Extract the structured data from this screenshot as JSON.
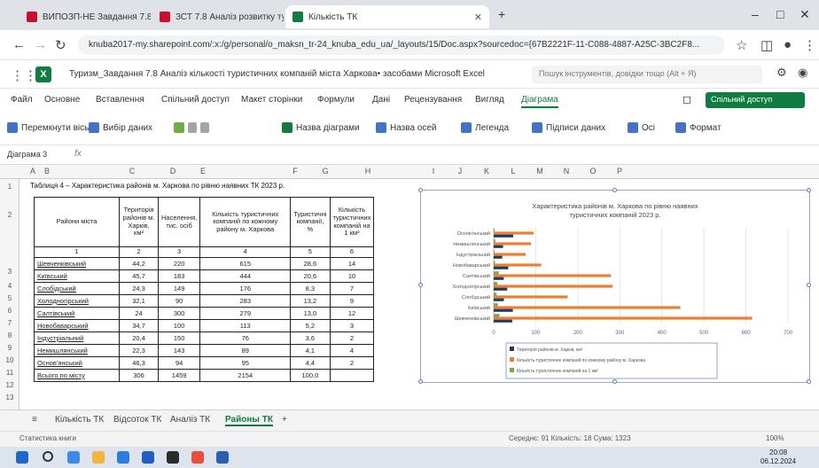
{
  "browser": {
    "tabs": [
      {
        "label": "ВИПОЗП-НЕ Завдання 7.8 Прог",
        "active": false
      },
      {
        "label": "ЗСТ 7.8 Аналіз розвитку турис",
        "active": false
      },
      {
        "label": "Кількість ТК",
        "active": true
      }
    ],
    "new_tab": "+",
    "url": "knuba2017-my.sharepoint.com/:x:/g/personal/o_maksn_tr-24_knuba_edu_ua/_layouts/15/Doc.aspx?sourcedoc={67B2221F-11-C088-4887-A25C-3BC2F8..."
  },
  "excel": {
    "logo": "X",
    "doc_title": "Туризм_Завдання 7.8 Аналіз кількості туристичних компаній міста Харкова• засобами Microsoft Excel",
    "search_placeholder": "Пошук інструментів, довідки тощо (Alt + Я)",
    "menu": [
      "Файл",
      "Основне",
      "Вставлення",
      "Спільний доступ",
      "Макет сторінки",
      "Формули",
      "Дані",
      "Рецензування",
      "Вигляд",
      "Діаграма"
    ],
    "share_label": "Спільний доступ",
    "toolbar": [
      "Перемкнути вісь",
      "Вибір даних",
      "Назва діаграми",
      "Назва осей",
      "Легенда",
      "Підписи даних",
      "Осі",
      "Формат"
    ],
    "name_box": "Діаграма 3",
    "fx": "fx"
  },
  "sheet": {
    "columns": [
      "A",
      "B",
      "C",
      "D",
      "E",
      "F",
      "G",
      "H",
      "I",
      "J",
      "K",
      "L",
      "M",
      "N",
      "O",
      "P"
    ],
    "rows": [
      "1",
      "2",
      "3",
      "4",
      "5",
      "6",
      "7",
      "8",
      "9",
      "10",
      "11",
      "12",
      "13"
    ],
    "caption": "Таблиця 4 – Характеристика районів м. Харкова по рівню наявних ТК 2023 р.",
    "headers": [
      "Райони міста",
      "Територія районів м. Харків, км²",
      "Населення, тис. осіб",
      "Кількість туристичних компаній по кожному району м. Харкова",
      "Туристичні компанії, %",
      "Кількість туристичних компаній на 1 км²"
    ],
    "index_row": [
      "1",
      "2",
      "3",
      "4",
      "5",
      "6"
    ],
    "data": [
      [
        "Шевченківський",
        "44,2",
        "220",
        "615",
        "28,6",
        "14"
      ],
      [
        "Київський",
        "45,7",
        "183",
        "444",
        "20,6",
        "10"
      ],
      [
        "Слобідський",
        "24,3",
        "149",
        "176",
        "8,3",
        "7"
      ],
      [
        "Холодногірський",
        "32,1",
        "90",
        "283",
        "13,2",
        "9"
      ],
      [
        "Салтівський",
        "24",
        "300",
        "279",
        "13,0",
        "12"
      ],
      [
        "Новобаварський",
        "34,7",
        "100",
        "113",
        "5,2",
        "3"
      ],
      [
        "Індустріальний",
        "20,4",
        "150",
        "76",
        "3,6",
        "2"
      ],
      [
        "Немишлянський",
        "22,3",
        "143",
        "89",
        "4,1",
        "4"
      ],
      [
        "Основ'янський",
        "46,3",
        "94",
        "95",
        "4,4",
        "2"
      ],
      [
        "Всього по місту",
        "306",
        "1459",
        "2154",
        "100,0",
        ""
      ]
    ]
  },
  "chart_data": {
    "type": "bar",
    "orientation": "horizontal",
    "title": "Характеристика районів м. Харкова по рівню наявних туристичних компаній 2023 р.",
    "categories": [
      "Основ'янський",
      "Немишлянський",
      "Індустріальний",
      "Новобаварський",
      "Салтівський",
      "Холодногірський",
      "Слобідський",
      "Київський",
      "Шевченківський"
    ],
    "series": [
      {
        "name": "Територія районів м. Харків, км²",
        "color": "#1f3864",
        "values": [
          46.3,
          22.3,
          20.4,
          34.7,
          24,
          32.1,
          24.3,
          45.7,
          44.2
        ]
      },
      {
        "name": "Кількість туристичних компаній по кожному району м. Харкова",
        "color": "#ed7d31",
        "values": [
          95,
          89,
          76,
          113,
          279,
          283,
          176,
          444,
          615
        ]
      },
      {
        "name": "Кількість туристичних компаній на 1 км²",
        "color": "#70ad47",
        "values": [
          2,
          4,
          2,
          3,
          12,
          9,
          7,
          10,
          14
        ]
      }
    ],
    "x_ticks": [
      "0",
      "100",
      "200",
      "300",
      "400",
      "500",
      "600",
      "700"
    ],
    "xlim": [
      0,
      700
    ],
    "grid": true,
    "legend": "bottom"
  },
  "sheet_tabs": {
    "tabs": [
      "Кількість ТК",
      "Відсоток ТК",
      "Аналіз ТК",
      "Районы ТК"
    ],
    "active": "Районы ТК",
    "add": "+"
  },
  "status_bar": {
    "left": "Статистика книги",
    "right": "Середнє: 91   Кількість: 18   Сума: 1323",
    "zoom": "100%"
  },
  "taskbar": {
    "time": "20:08",
    "date": "06.12.2024"
  }
}
